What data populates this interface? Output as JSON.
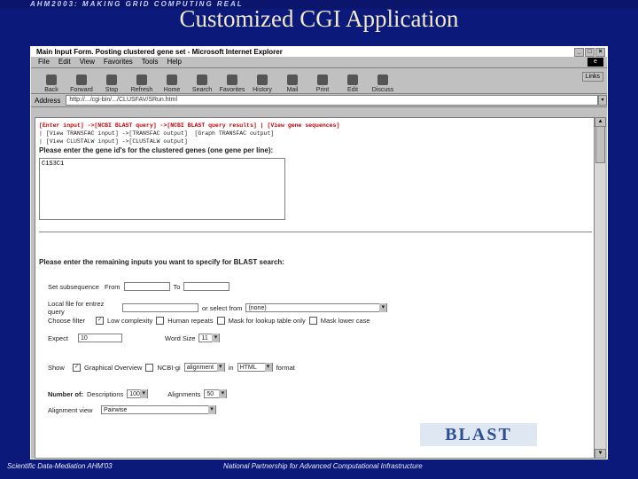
{
  "banner": "AHM2003: MAKING GRID COMPUTING REAL",
  "slide_title": "Customized CGI Application",
  "window": {
    "title": "Main Input Form. Posting clustered gene set - Microsoft Internet Explorer",
    "menu": [
      "File",
      "Edit",
      "View",
      "Favorites",
      "Tools",
      "Help"
    ],
    "toolbar": [
      "Back",
      "Forward",
      "Stop",
      "Refresh",
      "Home",
      "Search",
      "Favorites",
      "History",
      "Mail",
      "Print",
      "Edit",
      "Discuss"
    ],
    "links_label": "Links",
    "address_label": "Address",
    "address_value": "http://.../cgi-bin/.../CLUSFAV/SRun.html"
  },
  "content": {
    "nav_line1": "[Enter input] ->[NCBI BLAST query] ->[NCBI BLAST query results] | [View gene sequences]",
    "nav_line2": "| [View TRANSFAC input] ->[TRANSFAC output]  [Graph TRANSFAC output]",
    "nav_line3": "| [View CLUSTALW input] ->[CLUSTALW output]",
    "gene_prompt": "Please enter the gene id's for the clustered genes (one gene per line):",
    "gene_text": "C1S3C1",
    "blast_prompt": "Please enter the remaining inputs you want to specify for BLAST search:",
    "subseq_label": "Set subsequence",
    "from_label": "From",
    "to_label": "To",
    "local_label": "Local file for entrez query",
    "or_select": "or select from",
    "select_value": "(none)",
    "filter_label": "Choose filter",
    "filter_opts": [
      "Low complexity",
      "Human repeats",
      "Mask for lookup table only",
      "Mask lower case"
    ],
    "expect_label": "Expect",
    "expect_value": "10",
    "word_label": "Word Size",
    "word_value": "11",
    "graph_label": "Show",
    "graph_opt": "Graphical Overview",
    "ncbi_label": "NCBI-gi",
    "alignment_value": "alignment",
    "in_label": "in",
    "html_value": "HTML",
    "format_label": "format",
    "num_label": "Number of:",
    "desc_label": "Descriptions",
    "desc_value": "100",
    "align_label": "Alignments",
    "align_value": "50",
    "view_label": "Alignment view",
    "view_value": "Pairwise",
    "logo": "BLAST"
  },
  "footer_left": "Scientific Data-Mediation AHM'03",
  "footer_right": "National Partnership for Advanced Computational Infrastructure"
}
